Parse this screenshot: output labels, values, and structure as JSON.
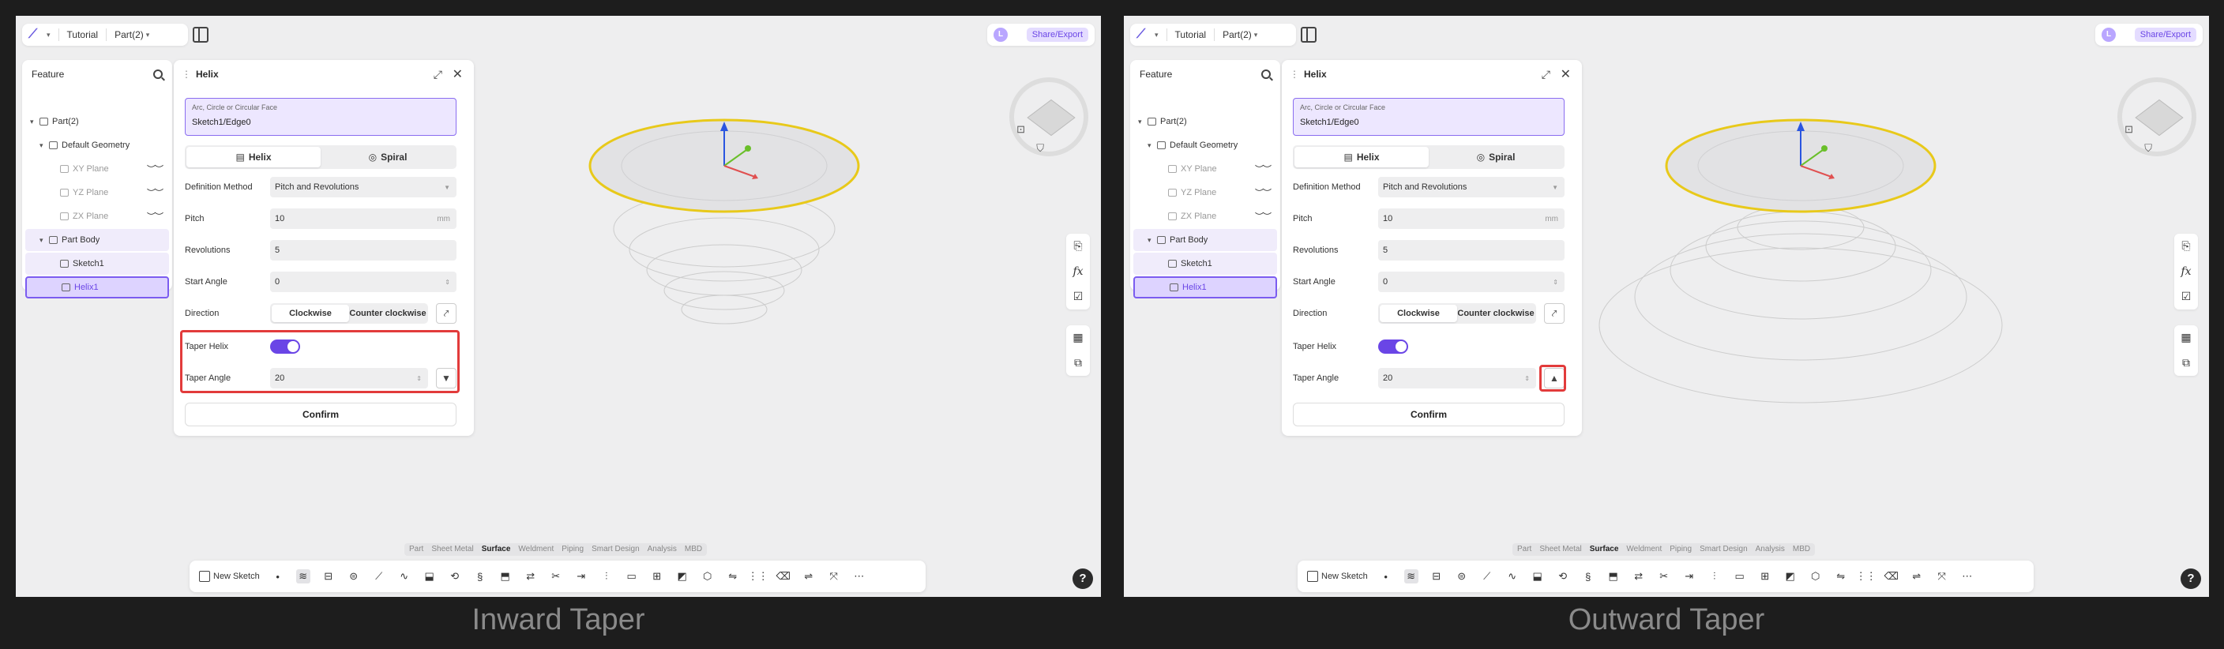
{
  "panels": [
    {
      "caption": "Inward Taper",
      "topbar": {
        "project": "Tutorial",
        "part": "Part(2)",
        "avatar": "L",
        "share_label": "Share/Export"
      },
      "feature": {
        "title": "Feature",
        "items": [
          {
            "label": "Part(2)"
          },
          {
            "label": "Default Geometry"
          },
          {
            "label": "XY Plane"
          },
          {
            "label": "YZ Plane"
          },
          {
            "label": "ZX Plane"
          },
          {
            "label": "Part Body"
          },
          {
            "label": "Sketch1"
          },
          {
            "label": "Helix1"
          }
        ]
      },
      "helix": {
        "title": "Helix",
        "selection_label": "Arc, Circle or Circular Face",
        "selection_value": "Sketch1/Edge0",
        "mode_helix": "Helix",
        "mode_spiral": "Spiral",
        "definition_label": "Definition Method",
        "definition_value": "Pitch and Revolutions",
        "pitch_label": "Pitch",
        "pitch_value": "10",
        "pitch_unit": "mm",
        "revolutions_label": "Revolutions",
        "revolutions_value": "5",
        "start_angle_label": "Start Angle",
        "start_angle_value": "0",
        "direction_label": "Direction",
        "clockwise": "Clockwise",
        "counter_clockwise": "Counter clockwise",
        "taper_helix_label": "Taper Helix",
        "taper_angle_label": "Taper Angle",
        "taper_angle_value": "20",
        "confirm": "Confirm"
      },
      "tabs": [
        "Part",
        "Sheet Metal",
        "Surface",
        "Weldment",
        "Piping",
        "Smart Design",
        "Analysis",
        "MBD"
      ],
      "new_sketch": "New Sketch",
      "taper_direction": "inward"
    },
    {
      "caption": "Outward Taper",
      "topbar": {
        "project": "Tutorial",
        "part": "Part(2)",
        "avatar": "L",
        "share_label": "Share/Export"
      },
      "feature": {
        "title": "Feature",
        "items": [
          {
            "label": "Part(2)"
          },
          {
            "label": "Default Geometry"
          },
          {
            "label": "XY Plane"
          },
          {
            "label": "YZ Plane"
          },
          {
            "label": "ZX Plane"
          },
          {
            "label": "Part Body"
          },
          {
            "label": "Sketch1"
          },
          {
            "label": "Helix1"
          }
        ]
      },
      "helix": {
        "title": "Helix",
        "selection_label": "Arc, Circle or Circular Face",
        "selection_value": "Sketch1/Edge0",
        "mode_helix": "Helix",
        "mode_spiral": "Spiral",
        "definition_label": "Definition Method",
        "definition_value": "Pitch and Revolutions",
        "pitch_label": "Pitch",
        "pitch_value": "10",
        "pitch_unit": "mm",
        "revolutions_label": "Revolutions",
        "revolutions_value": "5",
        "start_angle_label": "Start Angle",
        "start_angle_value": "0",
        "direction_label": "Direction",
        "clockwise": "Clockwise",
        "counter_clockwise": "Counter clockwise",
        "taper_helix_label": "Taper Helix",
        "taper_angle_label": "Taper Angle",
        "taper_angle_value": "20",
        "confirm": "Confirm"
      },
      "tabs": [
        "Part",
        "Sheet Metal",
        "Surface",
        "Weldment",
        "Piping",
        "Smart Design",
        "Analysis",
        "MBD"
      ],
      "new_sketch": "New Sketch",
      "taper_direction": "outward"
    }
  ],
  "colors": {
    "accent": "#6a45e6",
    "highlight": "#e23b3b",
    "face": "#e8c91a"
  }
}
